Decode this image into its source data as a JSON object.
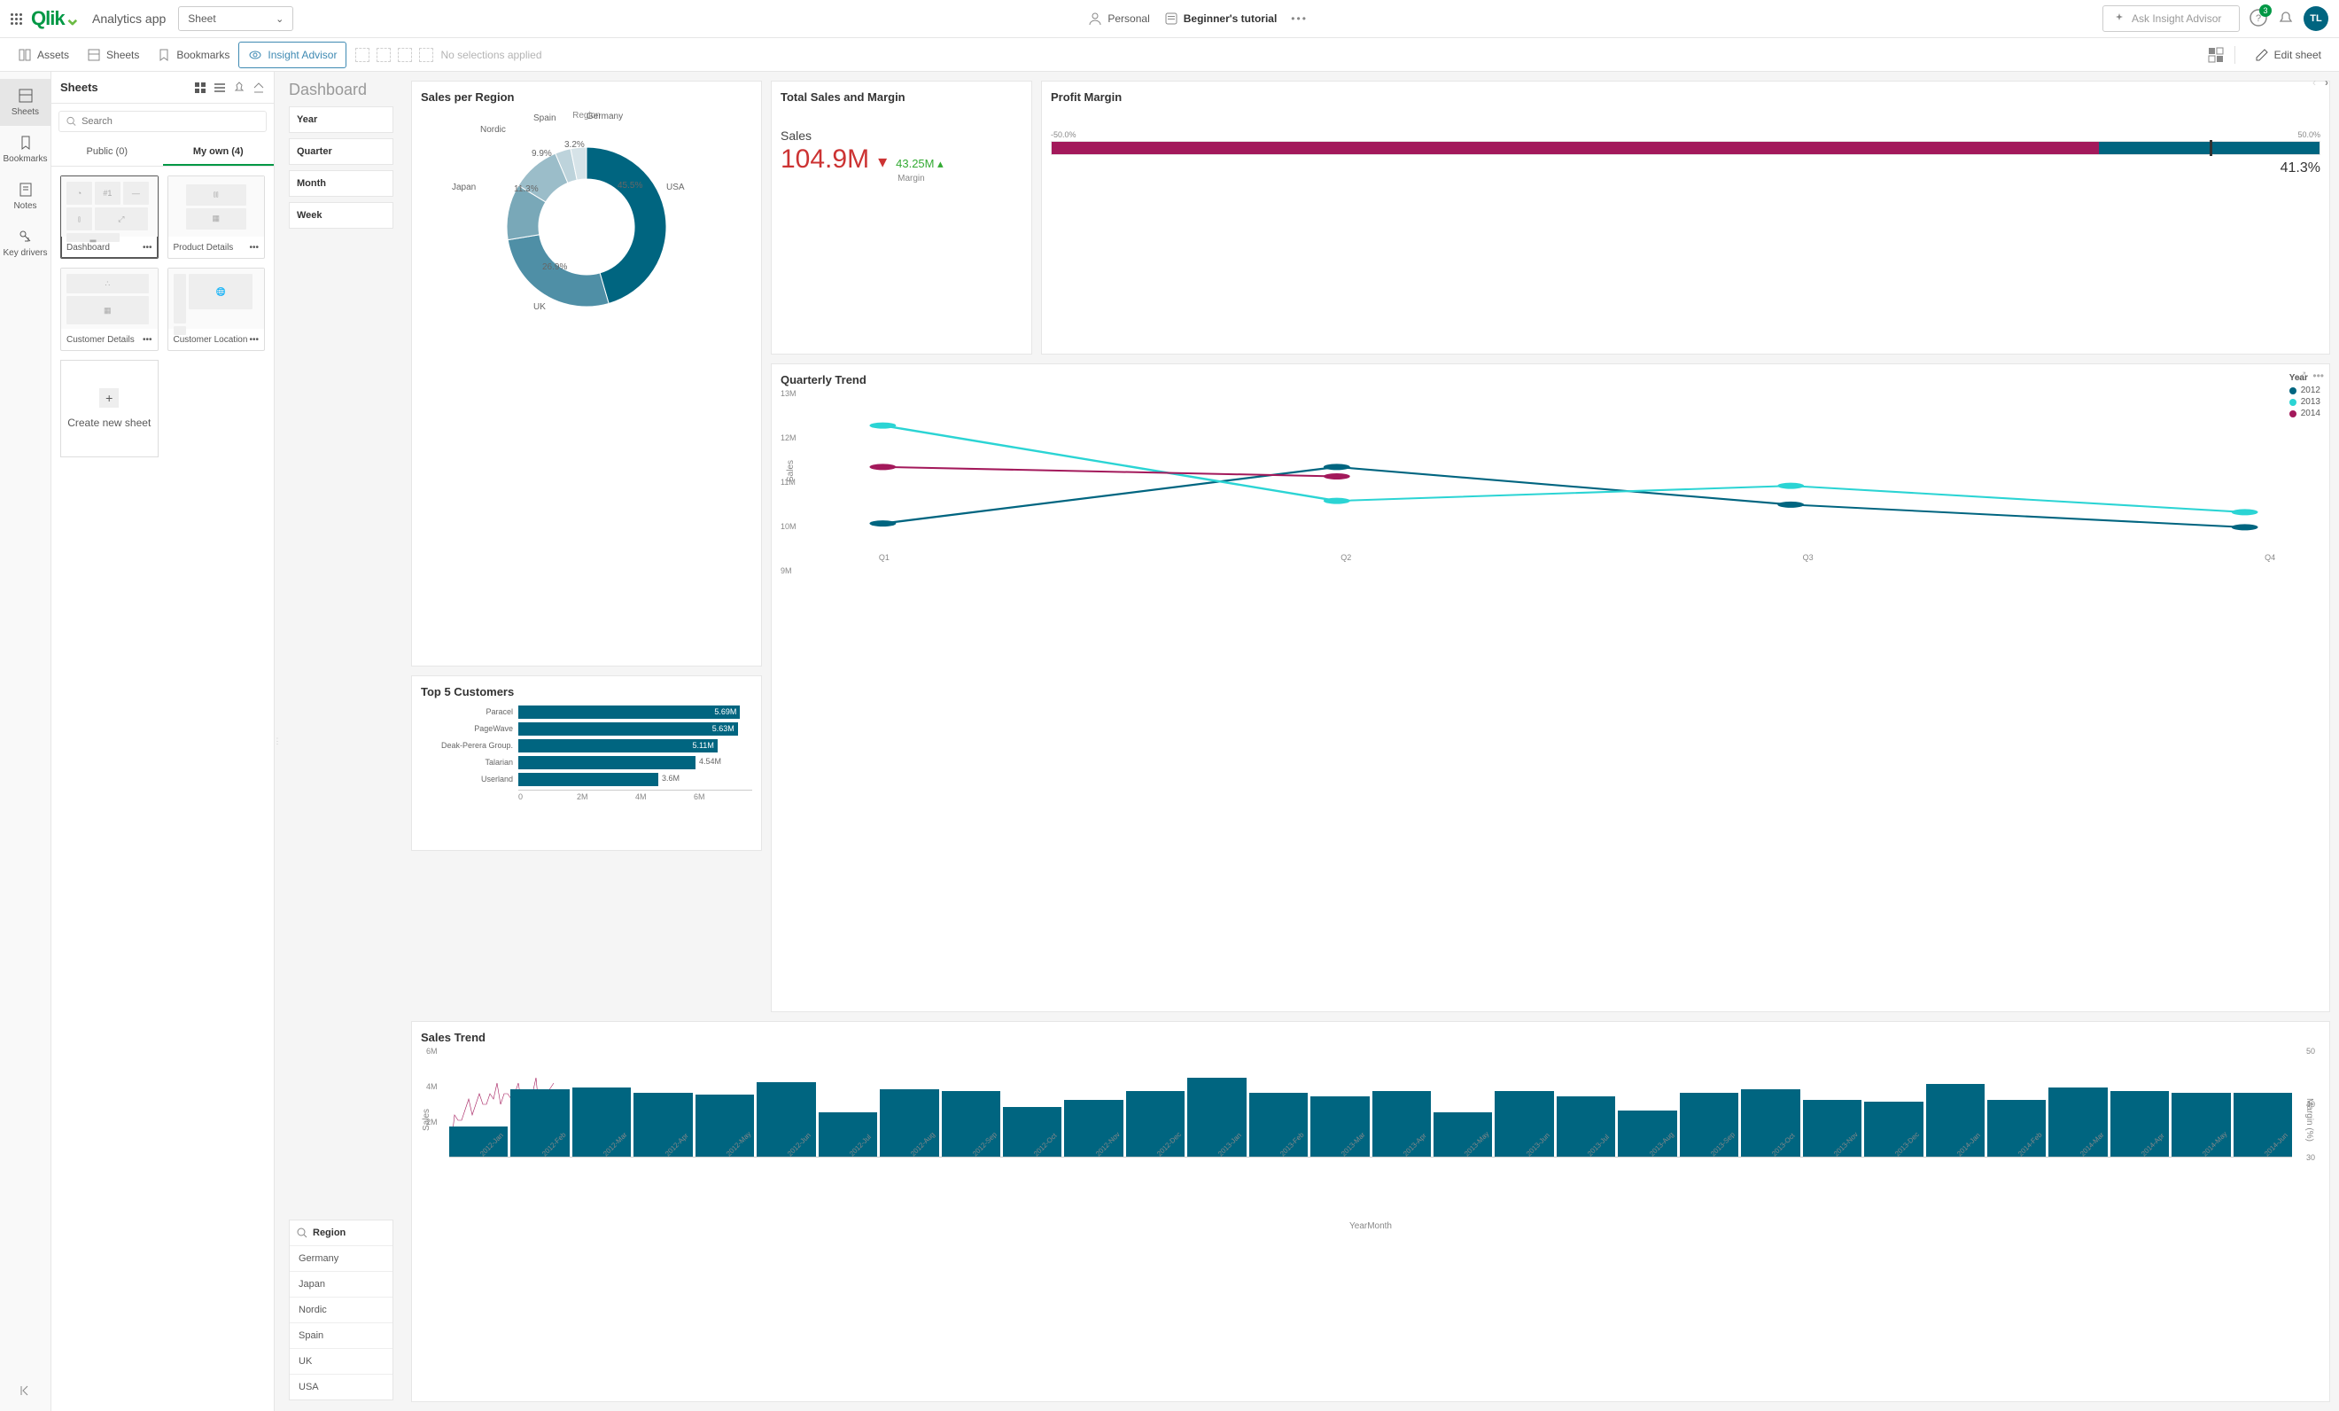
{
  "topbar": {
    "app_name": "Analytics app",
    "sheet_dropdown": "Sheet",
    "personal": "Personal",
    "tutorial": "Beginner's tutorial",
    "ask_placeholder": "Ask Insight Advisor",
    "help_badge": "3",
    "avatar": "TL"
  },
  "toolbar": {
    "assets": "Assets",
    "sheets": "Sheets",
    "bookmarks": "Bookmarks",
    "insight": "Insight Advisor",
    "no_selections": "No selections applied",
    "edit": "Edit sheet"
  },
  "rail": {
    "items": [
      "Sheets",
      "Bookmarks",
      "Notes",
      "Key drivers"
    ]
  },
  "panel": {
    "title": "Sheets",
    "search_placeholder": "Search",
    "tabs": [
      "Public (0)",
      "My own (4)"
    ],
    "thumbs": [
      "Dashboard",
      "Product Details",
      "Customer Details",
      "Customer Location"
    ],
    "new_sheet": "Create new sheet"
  },
  "filters": {
    "sheet_name": "Dashboard",
    "items": [
      "Year",
      "Quarter",
      "Month",
      "Week"
    ],
    "region_label": "Region",
    "regions": [
      "Germany",
      "Japan",
      "Nordic",
      "Spain",
      "UK",
      "USA"
    ]
  },
  "kpi": {
    "title": "Total Sales and Margin",
    "label": "Sales",
    "value": "104.9M",
    "delta": "43.25M",
    "delta_sub": "Margin"
  },
  "gauge": {
    "title": "Profit Margin",
    "low": "-50.0%",
    "high": "50.0%",
    "value": "41.3%"
  },
  "pie": {
    "title": "Sales per Region",
    "legend": "Region"
  },
  "top5": {
    "title": "Top 5 Customers"
  },
  "quarter": {
    "title": "Quarterly Trend",
    "legend_title": "Year",
    "ylab": "Sales"
  },
  "sales_trend": {
    "title": "Sales Trend",
    "xlab": "YearMonth",
    "ylab": "Sales",
    "y2lab": "Margin (%)"
  },
  "chart_data": [
    {
      "type": "pie",
      "title": "Sales per Region",
      "categories": [
        "USA",
        "UK",
        "Japan",
        "Nordic",
        "Spain",
        "Germany"
      ],
      "values": [
        45.5,
        26.9,
        11.3,
        9.9,
        3.2,
        3.2
      ],
      "colors": [
        "#006580",
        "#4f8fa6",
        "#79a8b8",
        "#9bbdc9",
        "#bdd3db",
        "#d6e3e8"
      ]
    },
    {
      "type": "bar",
      "title": "Top 5 Customers",
      "categories": [
        "Paracel",
        "PageWave",
        "Deak-Perera Group.",
        "Talarian",
        "Userland"
      ],
      "values": [
        5.69,
        5.63,
        5.11,
        4.54,
        3.6
      ],
      "xlim": [
        0,
        6
      ],
      "xticks": [
        0,
        2,
        4,
        6
      ],
      "unit": "M"
    },
    {
      "type": "line",
      "title": "Quarterly Trend",
      "x": [
        "Q1",
        "Q2",
        "Q3",
        "Q4"
      ],
      "series": [
        {
          "name": "2012",
          "color": "#006580",
          "values": [
            9.55,
            11.05,
            10.05,
            9.45
          ]
        },
        {
          "name": "2013",
          "color": "#2bd4d4",
          "values": [
            12.15,
            10.15,
            10.55,
            9.85
          ]
        },
        {
          "name": "2014",
          "color": "#a3195b",
          "values": [
            11.05,
            10.8,
            null,
            null
          ]
        }
      ],
      "ylim": [
        9,
        13
      ],
      "yticks": [
        9,
        10,
        11,
        12,
        13
      ],
      "ylabel": "Sales",
      "yunit": "M"
    },
    {
      "type": "bar",
      "title": "Sales Trend",
      "categories": [
        "2012-Jan",
        "2012-Feb",
        "2012-Mar",
        "2012-Apr",
        "2012-May",
        "2012-Jun",
        "2012-Jul",
        "2012-Aug",
        "2012-Sep",
        "2012-Oct",
        "2012-Nov",
        "2012-Dec",
        "2013-Jan",
        "2013-Feb",
        "2013-Mar",
        "2013-Apr",
        "2013-May",
        "2013-Jun",
        "2013-Jul",
        "2013-Aug",
        "2013-Sep",
        "2013-Oct",
        "2013-Nov",
        "2013-Dec",
        "2014-Jan",
        "2014-Feb",
        "2014-Mar",
        "2014-Apr",
        "2014-May",
        "2014-Jun"
      ],
      "values": [
        1.7,
        3.8,
        3.9,
        3.6,
        3.5,
        4.2,
        2.5,
        3.8,
        3.7,
        2.8,
        3.2,
        3.7,
        4.5,
        3.6,
        3.4,
        3.7,
        2.5,
        3.7,
        3.4,
        2.6,
        3.6,
        3.8,
        3.2,
        3.1,
        4.1,
        3.2,
        3.9,
        3.7,
        3.6,
        3.6
      ],
      "ylim": [
        0,
        6
      ],
      "yticks": [
        2,
        4,
        6
      ],
      "yunit": "M",
      "ylabel": "Sales",
      "xlabel": "YearMonth",
      "secondary": {
        "type": "line",
        "name": "Margin (%)",
        "values": [
          32,
          38,
          37,
          37,
          39,
          41,
          38,
          40,
          42,
          40,
          40,
          42,
          41,
          44,
          40,
          42,
          42,
          41,
          42,
          44,
          40,
          42,
          41,
          42,
          45,
          38,
          42,
          42,
          43,
          44
        ],
        "ylim": [
          30,
          50
        ],
        "yticks": [
          30,
          40,
          50
        ],
        "color": "#a3195b"
      }
    }
  ]
}
